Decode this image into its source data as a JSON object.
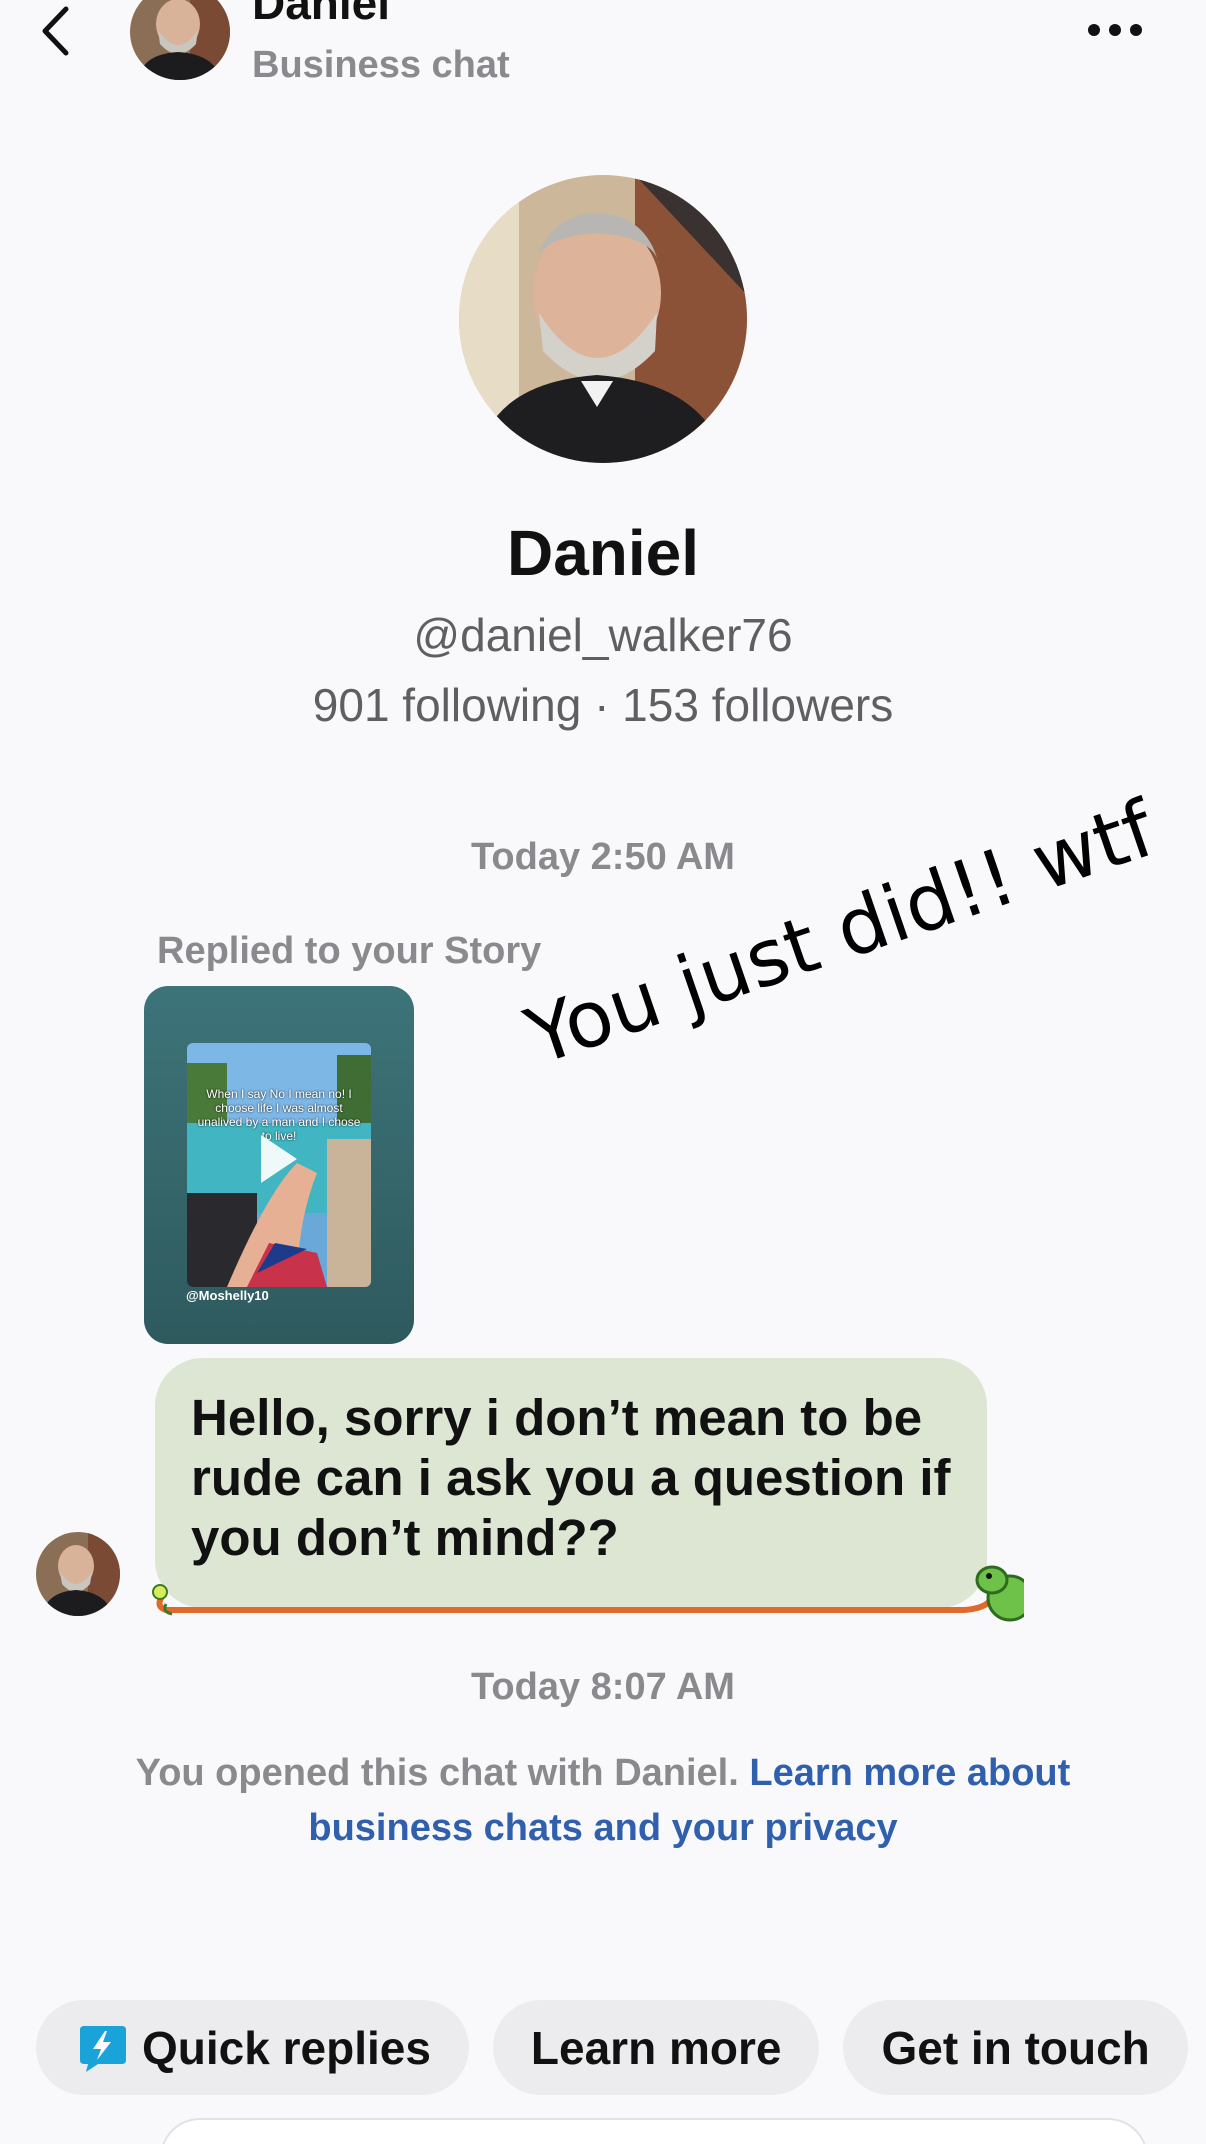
{
  "header": {
    "name": "Daniel",
    "subtitle": "Business chat",
    "avatar_icon": "user-avatar"
  },
  "profile": {
    "name": "Daniel",
    "handle": "@daniel_walker76",
    "stats": "901 following · 153 followers"
  },
  "conversation": {
    "timestamp_1": "Today 2:50 AM",
    "replied_label": "Replied to your Story",
    "story": {
      "caption": "When I say No I mean no! I choose life I was almost unalived by a man and I chose to live!",
      "handle": "@Moshelly10"
    },
    "story_overlay_text": "You just did!! wtf",
    "message": "Hello, sorry i don’t mean to be rude can i ask you a question if you don’t mind??",
    "timestamp_2": "Today 8:07 AM",
    "privacy_text": "You opened this chat with Daniel. ",
    "privacy_link": "Learn more about business chats and your privacy"
  },
  "quick_actions": [
    {
      "label": "Quick replies",
      "icon": "lightning-icon"
    },
    {
      "label": "Learn more"
    },
    {
      "label": "Get in touch"
    }
  ],
  "colors": {
    "background": "#f9f9fb",
    "bubble": "#dce6d3",
    "link": "#2f5fad",
    "chip": "#ececef",
    "muted_text": "#8a8a8e"
  }
}
